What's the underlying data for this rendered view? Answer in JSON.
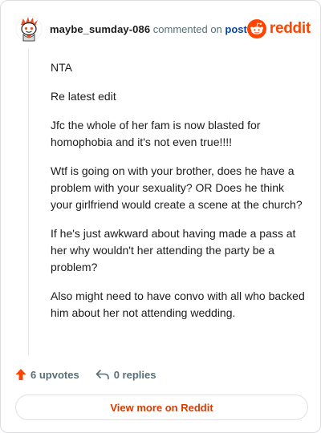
{
  "comment": {
    "author": "maybe_sumday-086",
    "action_text": "commented on",
    "post_link": "post",
    "paragraphs": [
      "NTA",
      "Re latest edit",
      "Jfc the whole of her fam is now blasted for homophobia and it's not even true!!!!",
      "Wtf is going on with your brother, does he have a problem with your sexuality? OR Does he think your girlfriend would create a scene at the church?",
      "If he's just awkward about having made a pass at her why wouldn't her attending the party be a problem?",
      "Also might need to have convo with all who backed him about her not attending wedding."
    ],
    "upvotes": "6 upvotes",
    "replies": "0 replies"
  },
  "brand": {
    "wordmark": "reddit",
    "color": "#ff4500"
  },
  "footer": {
    "view_button": "View more on Reddit"
  },
  "icons": {
    "avatar": "snoo-avatar-icon",
    "logo": "reddit-logo-icon",
    "upvote": "upvote-arrow-icon",
    "reply": "reply-arrow-icon"
  }
}
